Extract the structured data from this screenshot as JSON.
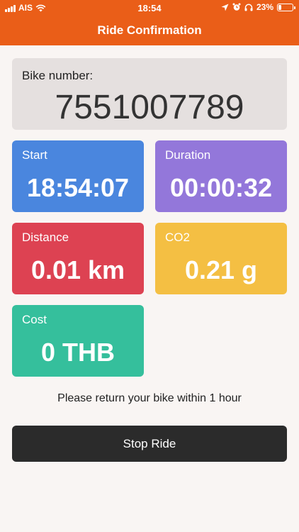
{
  "status_bar": {
    "carrier": "AIS",
    "time": "18:54",
    "battery_percent": "23%",
    "battery_level": 0.23
  },
  "header": {
    "title": "Ride Confirmation",
    "background_color": "#ea5e18"
  },
  "bike": {
    "label": "Bike number:",
    "number": "7551007789"
  },
  "tiles": [
    {
      "label": "Start",
      "value": "18:54:07",
      "color": "#4a86de"
    },
    {
      "label": "Duration",
      "value": "00:00:32",
      "color": "#9377da"
    },
    {
      "label": "Distance",
      "value": "0.01 km",
      "color": "#dd4252"
    },
    {
      "label": "CO2",
      "value": "0.21 g",
      "color": "#f4bf43"
    },
    {
      "label": "Cost",
      "value": "0 THB",
      "color": "#35bf9c"
    }
  ],
  "notice": "Please return your bike within 1 hour",
  "actions": {
    "stop_ride_label": "Stop Ride"
  }
}
